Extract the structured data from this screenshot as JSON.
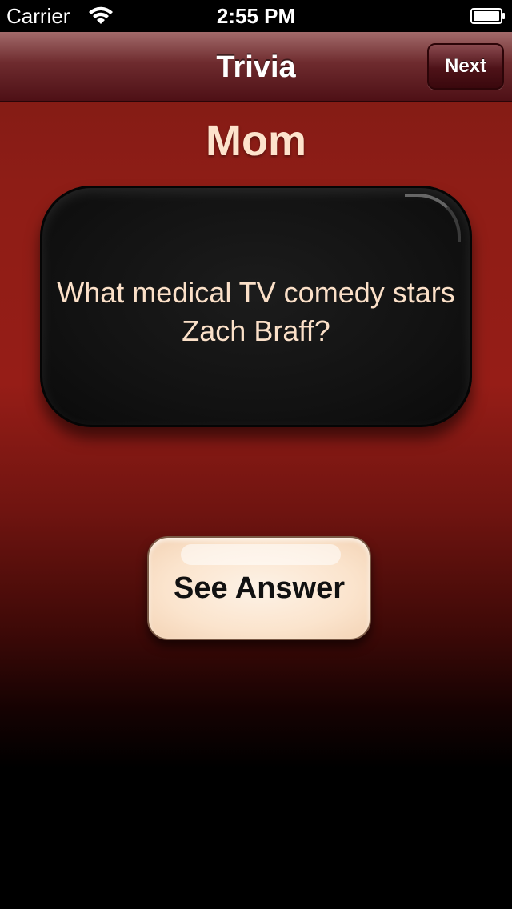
{
  "status_bar": {
    "carrier": "Carrier",
    "time": "2:55 PM",
    "wifi_icon": "wifi-icon",
    "battery_icon": "battery-icon"
  },
  "nav_bar": {
    "title": "Trivia",
    "next_label": "Next"
  },
  "content": {
    "category": "Mom",
    "question": "What medical TV comedy stars Zach Braff?",
    "see_answer_label": "See Answer"
  },
  "colors": {
    "background_top": "#8e1d16",
    "background_bottom": "#000000",
    "accent_text": "#fde3cc",
    "card": "#121212",
    "button": "#fbe4cd"
  }
}
